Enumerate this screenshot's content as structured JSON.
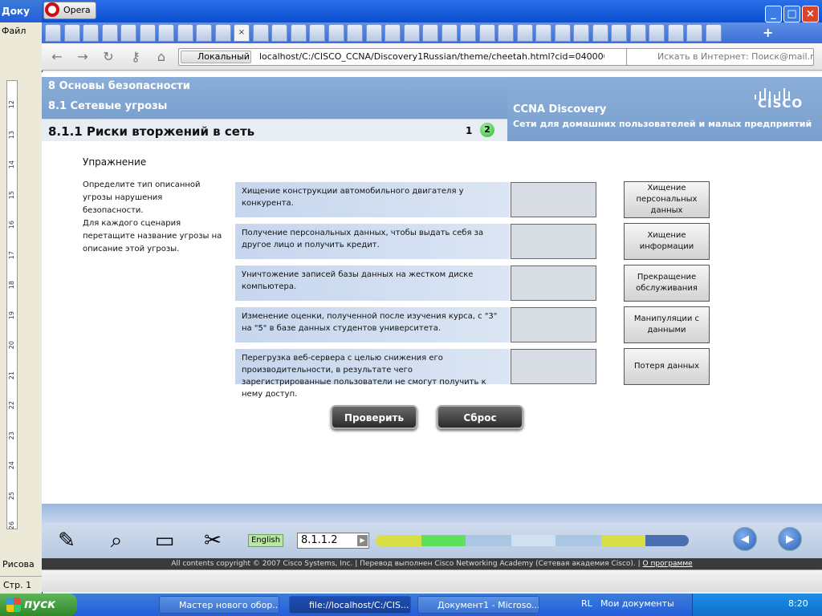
{
  "word": {
    "title": "Доку",
    "menu_file": "Файл",
    "draw_label": "Рисова",
    "status_page": "Стр. 1",
    "ruler_numbers": [
      "12",
      "13",
      "14",
      "15",
      "16",
      "17",
      "18",
      "19",
      "20",
      "21",
      "22",
      "23",
      "24",
      "25",
      "26"
    ]
  },
  "opera": {
    "menu_label": "Opera",
    "address_local": "Локальный",
    "url": "localhost/C:/CISCO_CCNA/Discovery1Russian/theme/cheetah.html?cid=0400000000&l1",
    "search_placeholder": "Искать в Интернет: Поиск@mail.ru"
  },
  "header": {
    "chapter": "8 Основы безопасности",
    "section": "8.1 Сетевые угрозы",
    "subtitle": "8.1.1 Риски вторжений в сеть",
    "page_current": "1",
    "page_active": "2",
    "brand": "CCNA Discovery",
    "brand_sub": "Сети для домашних пользователей и малых предприятий",
    "logo": "CISCO"
  },
  "exercise": {
    "title": "Упражнение",
    "instruction1": "Определите тип описанной угрозы нарушения безопасности.",
    "instruction2": "Для каждого сценария перетащите название угрозы на описание этой угрозы.",
    "scenarios": [
      "Хищение конструкции автомобильного двигателя у конкурента.",
      "Получение персональных данных, чтобы выдать себя за другое лицо и получить кредит.",
      "Уничтожение записей базы данных на жестком диске компьютера.",
      "Изменение оценки, полученной после изучения курса, с \"3\" на \"5\" в базе данных студентов университета.",
      "Перегрузка веб-сервера с целью снижения его производительности, в результате чего зарегистрированные пользователи не смогут получить к нему доступ."
    ],
    "options": [
      "Хищение персональных данных",
      "Хищение информации",
      "Прекращение обслуживания",
      "Манипуляции с данными",
      "Потеря данных"
    ],
    "check_label": "Проверить",
    "reset_label": "Сброс"
  },
  "footer": {
    "language": "English",
    "page_field": "8.1.1.2",
    "copyright": "All contents copyright © 2007 Cisco Systems, Inc. | Перевод выполнен Cisco Networking Academy (Сетевая академия Cisco). |",
    "about_link": "О программе",
    "progress_colors": [
      "#d9df43",
      "#5ee05a",
      "#a9c6e2",
      "#cfe0ef",
      "#a9c6e2",
      "#d9df43",
      "#4a6fb0"
    ]
  },
  "taskbar": {
    "start": "пуск",
    "items": [
      "Мастер нового обор...",
      "file://localhost/C:/CIS...",
      "Документ1 - Microso..."
    ],
    "lang": "RL",
    "my_docs": "Мои документы",
    "time": "8:20"
  }
}
